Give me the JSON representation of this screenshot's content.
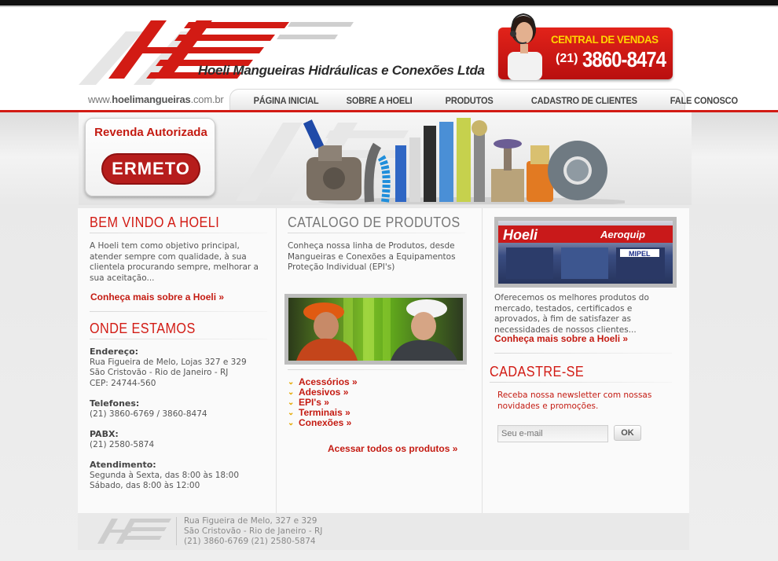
{
  "header": {
    "company_name": "Hoeli Mangueiras Hidráulicas e Conexões Ltda",
    "site_url_prefix": "www.",
    "site_url_domain": "hoelimangueiras",
    "site_url_suffix": ".com.br",
    "sales_title": "CENTRAL DE VENDAS",
    "sales_area_code": "(21)",
    "sales_phone": "3860-8474"
  },
  "nav": {
    "items": [
      {
        "label": "PÁGINA INICIAL"
      },
      {
        "label": "SOBRE A HOELI"
      },
      {
        "label": "PRODUTOS"
      },
      {
        "label": "CADASTRO DE CLIENTES"
      },
      {
        "label": "FALE CONOSCO"
      }
    ]
  },
  "banner": {
    "reseller_title": "Revenda Autorizada",
    "reseller_brand": "ERMETO"
  },
  "welcome": {
    "title": "BEM VINDO A HOELI",
    "text": "A Hoeli tem como objetivo principal, atender sempre com qualidade, à sua clientela procurando sempre, melhorar a sua aceitação...",
    "link": "Conheça mais sobre a Hoeli »"
  },
  "location": {
    "title": "ONDE ESTAMOS",
    "address_label": "Endereço:",
    "address_lines": [
      "Rua Figueira de Melo, Lojas 327 e 329",
      "São Cristovão - Rio de Janeiro - RJ",
      "CEP: 24744-560"
    ],
    "phones_label": "Telefones:",
    "phones": "(21) 3860-6769 / 3860-8474",
    "pabx_label": "PABX:",
    "pabx": "(21) 2580-5874",
    "hours_label": "Atendimento:",
    "hours_lines": [
      "Segunda à Sexta, das 8:00 às 18:00",
      "Sábado, das 8:00 às 12:00"
    ]
  },
  "catalog": {
    "title": "CATALOGO DE PRODUTOS",
    "text": "Conheça nossa linha de Produtos, desde Mangueiras e Conexões a Equipamentos Proteção Individual (EPI's)",
    "items": [
      "Acessórios »",
      "Adesivos »",
      "EPI's »",
      "Terminais »",
      "Conexões »"
    ],
    "all_link": "Acessar todos os produtos »"
  },
  "about": {
    "text": "Oferecemos os melhores produtos do mercado, testados, certificados e aprovados, à fim de satisfazer as necessidades de nossos clientes...",
    "link": "Conheça mais sobre a Hoeli »",
    "store_sign_1": "Hoeli",
    "store_sign_2": "Aeroquip",
    "store_sign_3": "MIPEL"
  },
  "signup": {
    "title": "CADASTRE-SE",
    "text": "Receba nossa newsletter com nossas novidades e promoções.",
    "email_placeholder": "Seu e-mail",
    "button": "OK"
  },
  "footer": {
    "lines": [
      "Rua Figueira de Melo, 327 e 329",
      "São Cristovão - Rio de Janeiro - RJ",
      "(21)  3860-6769 (21) 2580-5874"
    ]
  },
  "colors": {
    "brand_red": "#d21b14",
    "accent_yellow": "#ffd400",
    "text_gray": "#555555"
  }
}
